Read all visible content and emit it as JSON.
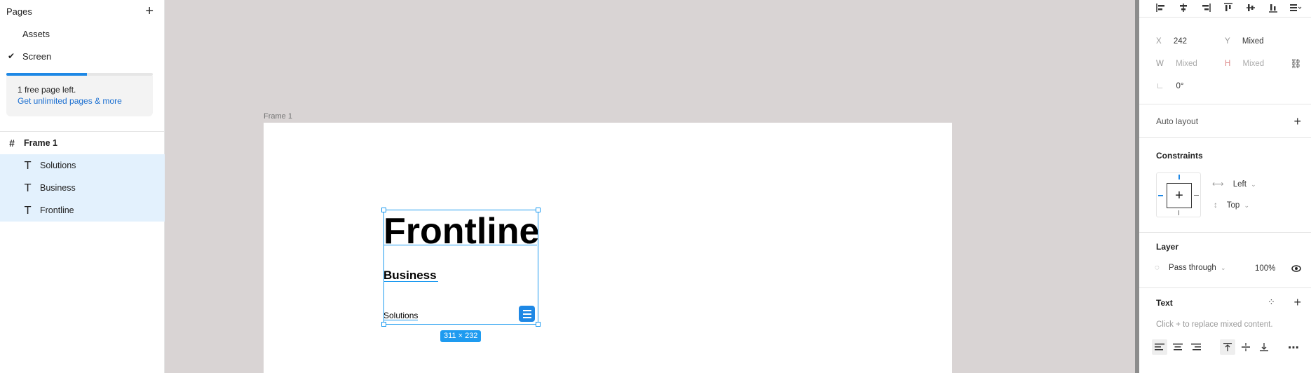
{
  "left_panel": {
    "pages_title": "Pages",
    "add_icon": "plus-icon",
    "pages": [
      {
        "label": "Assets",
        "active": false
      },
      {
        "label": "Screen",
        "active": true
      }
    ],
    "check_glyph": "✔",
    "free_page_progress": 0.55,
    "upsell_text": "1 free page left.",
    "upsell_link": "Get unlimited pages & more",
    "layers": [
      {
        "label": "Frame 1",
        "type": "frame",
        "glyph": "#"
      },
      {
        "label": "Solutions",
        "type": "text",
        "glyph": "T"
      },
      {
        "label": "Business",
        "type": "text",
        "glyph": "T"
      },
      {
        "label": "Frontline",
        "type": "text",
        "glyph": "T"
      }
    ]
  },
  "canvas": {
    "frame_label": "Frame 1",
    "texts": {
      "frontline": "Frontline",
      "business": "Business",
      "solutions": "Solutions"
    },
    "size_badge": "311 × 232",
    "accent": "#1e9bf0"
  },
  "right_panel": {
    "position": {
      "x_label": "X",
      "x_value": "242",
      "y_label": "Y",
      "y_value": "Mixed",
      "w_label": "W",
      "w_value": "Mixed",
      "h_label": "H",
      "h_value": "Mixed",
      "rotation_value": "0°"
    },
    "auto_layout_title": "Auto layout",
    "constraints_title": "Constraints",
    "constraint_horizontal": "Left",
    "constraint_vertical": "Top",
    "layer_title": "Layer",
    "blend_mode": "Pass through",
    "opacity": "100%",
    "text_title": "Text",
    "text_hint": "Click + to replace mixed content."
  }
}
